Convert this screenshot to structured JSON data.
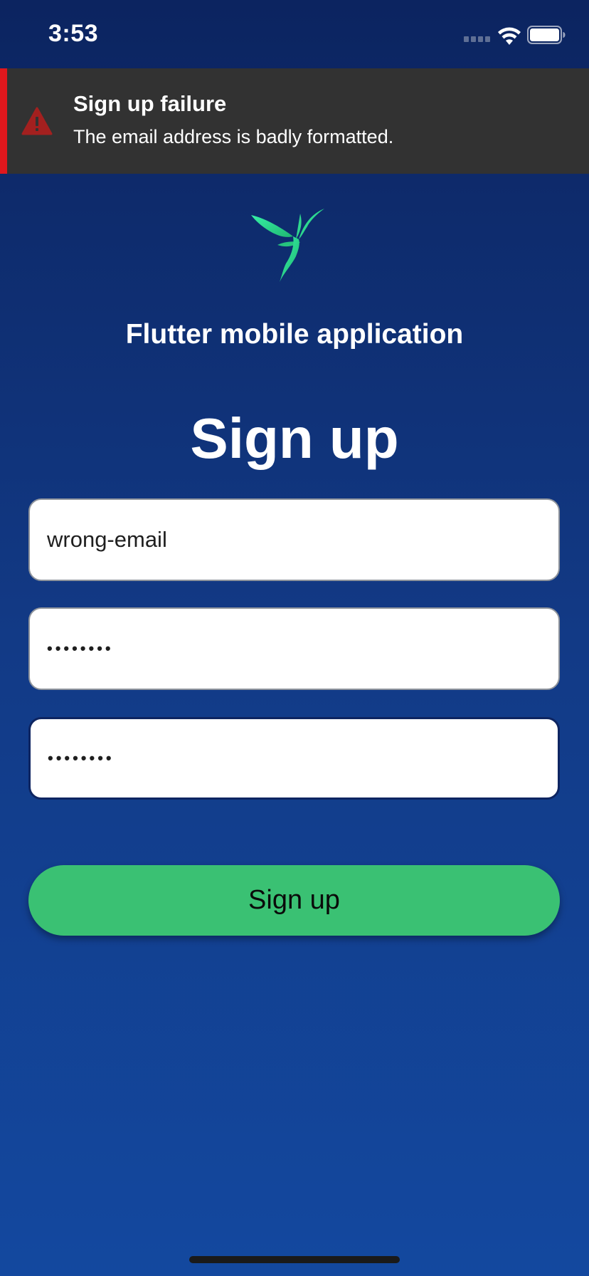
{
  "status_bar": {
    "time": "3:53"
  },
  "toast": {
    "title": "Sign up failure",
    "message": "The email address is badly formatted.",
    "icon": "warning-icon",
    "accent_color": "#e0171d"
  },
  "logo": {
    "icon": "hummingbird-logo"
  },
  "app_name": "Flutter mobile application",
  "page_title": "Sign up",
  "form": {
    "email_value": "wrong-email",
    "password_value": "••••••••",
    "confirm_password_value": "••••••••",
    "submit_label": "Sign up"
  },
  "colors": {
    "background_top": "#0c2460",
    "background_bottom": "#13489f",
    "button": "#3ac173",
    "toast_background": "#323232"
  }
}
